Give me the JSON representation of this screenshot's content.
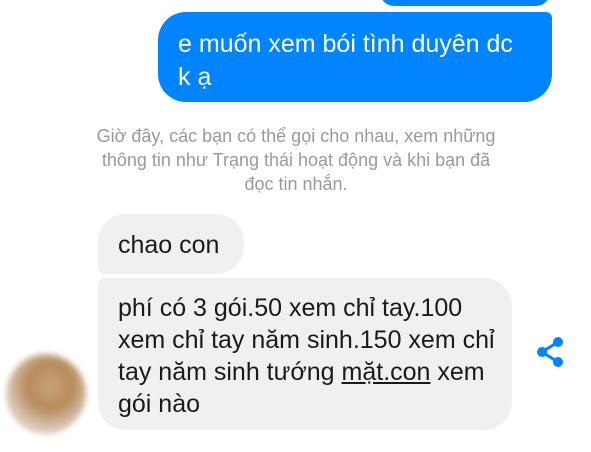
{
  "conversation": {
    "outgoing_message": "e muốn xem bói tình duyên dc k ạ",
    "system_note": "Giờ đây, các bạn có thể gọi cho nhau, xem những thông tin như Trạng thái hoạt động và khi bạn đã đọc tin nhắn.",
    "incoming_message_1": "chao con",
    "incoming_message_2_text": "phí có 3 gói.50 xem chỉ tay.100 xem chỉ tay năm sinh.150 xem chỉ tay năm sinh tướng ",
    "incoming_message_2_link": "mặt.con",
    "incoming_message_2_tail": " xem gói nào"
  },
  "colors": {
    "outgoing_bubble": "#0084ff",
    "incoming_bubble": "#f1f0f0",
    "share_icon": "#0084ff",
    "system_text": "#9a9a9a"
  },
  "icons": {
    "share": "share-icon"
  }
}
